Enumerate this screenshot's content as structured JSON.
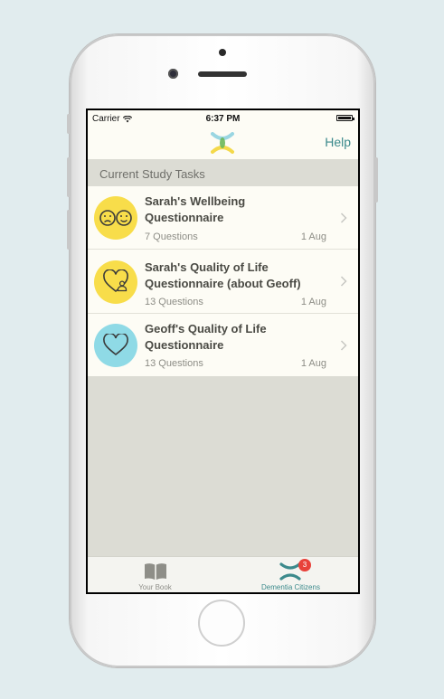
{
  "status_bar": {
    "carrier": "Carrier",
    "time": "6:37 PM"
  },
  "nav": {
    "help_label": "Help",
    "logo_icon": "dementia-citizens-logo-icon"
  },
  "section": {
    "title": "Current Study Tasks"
  },
  "tasks": [
    {
      "title_line1": "Sarah's Wellbeing",
      "title_line2": "Questionnaire",
      "questions": "7 Questions",
      "date": "1 Aug",
      "icon": "faces-icon",
      "icon_bg": "#f8dd4a"
    },
    {
      "title_line1": "Sarah's Quality of Life",
      "title_line2": "Questionnaire (about Geoff)",
      "questions": "13 Questions",
      "date": "1 Aug",
      "icon": "heart-person-icon",
      "icon_bg": "#f8dd4a"
    },
    {
      "title_line1": "Geoff's Quality of Life",
      "title_line2": "Questionnaire",
      "questions": "13 Questions",
      "date": "1 Aug",
      "icon": "heart-icon",
      "icon_bg": "#8fdae6"
    }
  ],
  "tabbar": {
    "items": [
      {
        "label": "Your Book",
        "icon": "book-icon"
      },
      {
        "label": "Dementia Citizens",
        "icon": "dementia-citizens-logo-icon",
        "badge": "3"
      }
    ]
  },
  "colors": {
    "accent": "#3c8a8c",
    "yellow": "#f8dd4a",
    "cyan": "#8fdae6",
    "badge": "#e8413a"
  }
}
